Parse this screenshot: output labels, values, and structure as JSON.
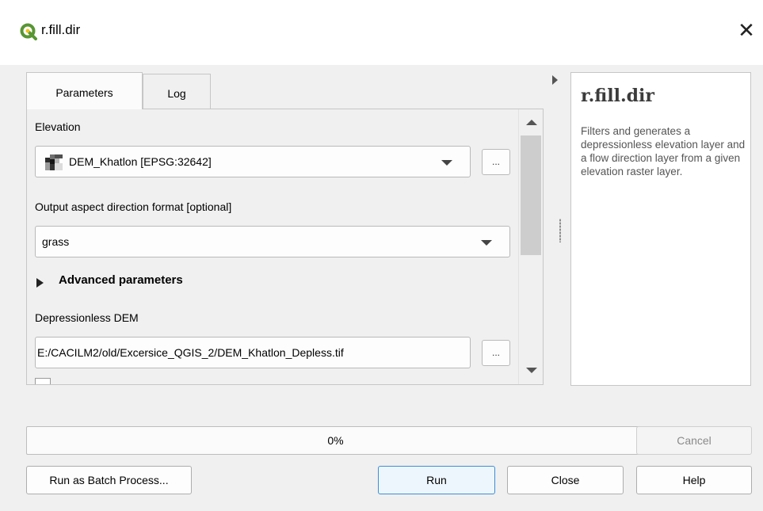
{
  "window": {
    "title": "r.fill.dir",
    "app_icon": "qgis-logo-icon",
    "close_icon": "close-icon"
  },
  "tabs": [
    {
      "label": "Parameters",
      "active": true
    },
    {
      "label": "Log",
      "active": false
    }
  ],
  "parameters": {
    "elevation_label": "Elevation",
    "elevation_value": "DEM_Khatlon [EPSG:32642]",
    "elevation_icon": "raster-layer-icon",
    "aspect_label": "Output aspect direction format [optional]",
    "aspect_value": "grass",
    "advanced_label": "Advanced parameters",
    "depressionless_label": "Depressionless DEM",
    "depressionless_value": "E:/CACILM2/old/Excersice_QGIS_2/DEM_Khatlon_Depless.tif",
    "browse_label": "..."
  },
  "help": {
    "title": "r.fill.dir",
    "description": "Filters and generates a depressionless elevation layer and a flow direction layer from a given elevation raster layer."
  },
  "progress": {
    "text": "0%",
    "value": 0
  },
  "buttons": {
    "cancel": "Cancel",
    "batch": "Run as Batch Process...",
    "run": "Run",
    "close": "Close",
    "help": "Help"
  },
  "colors": {
    "accent": "#3a8fd6",
    "qgis_green": "#589632",
    "qgis_yellow": "#f0c419"
  }
}
